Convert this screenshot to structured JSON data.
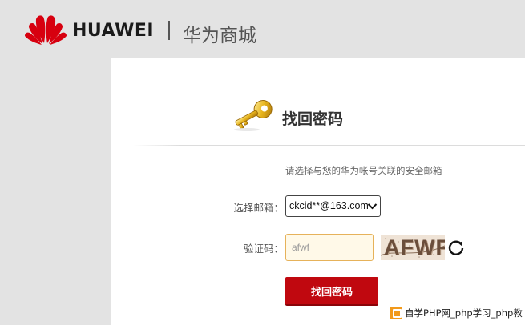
{
  "header": {
    "brand": "HUAWEI",
    "mall_name": "华为商城"
  },
  "panel": {
    "title": "找回密码",
    "instruction": "请选择与您的华为帐号关联的安全邮箱",
    "email_label": "选择邮箱：",
    "email_selected": "ckcid**@163.com",
    "captcha_label": "验证码：",
    "captcha_input_value": "afwf",
    "captcha_image_text": "AFWF",
    "submit_label": "找回密码"
  },
  "icons": {
    "logo": "huawei-petal-logo",
    "key": "golden-key-icon",
    "refresh": "refresh-icon",
    "chevron": "chevron-down-icon"
  },
  "colors": {
    "brand_red": "#c0080f",
    "input_border": "#e6b25a",
    "input_bg": "#fff9e8",
    "page_bg": "#e3e3e3"
  },
  "watermark": {
    "text": "自学PHP网_php学习_php教"
  }
}
